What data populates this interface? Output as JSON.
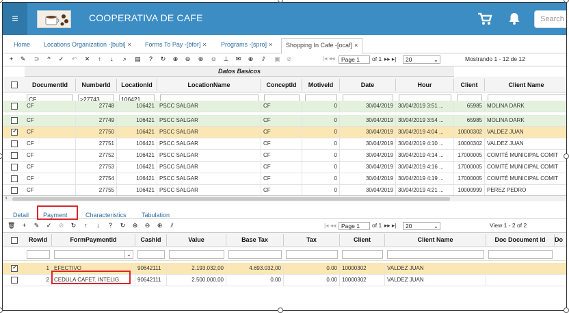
{
  "app": {
    "title": "COOPERATIVA DE CAFE",
    "search_placeholder": "Search"
  },
  "tabs": [
    {
      "label": "Home"
    },
    {
      "label": "Locations Organization -[bubi]"
    },
    {
      "label": "Forms To Pay -[bfor]"
    },
    {
      "label": "Programs -[spro]"
    },
    {
      "label": "Shopping In Cafe -[ocaf]"
    }
  ],
  "top_pager": {
    "page_label": "Page 1",
    "of_label": "of 1",
    "page_size": "20",
    "summary": "Mostrando 1 - 12 de 12"
  },
  "top_grid": {
    "group_header": "Datos Basicos",
    "columns": [
      "DocumentId",
      "NumberId",
      "LocationId",
      "LocationName",
      "ConceptId",
      "MotiveId",
      "Date",
      "Hour",
      "Client",
      "Client Name"
    ],
    "filters": {
      "document_id": "CF",
      "number_id": ">27743",
      "location_id": "106421"
    },
    "rows": [
      {
        "doc": "CF",
        "num": "27748",
        "loc": "106421",
        "name": "PSCC SALGAR",
        "concept": "CF",
        "motive": "0",
        "date": "30/04/2019",
        "hour": "30/04/2019 3:51 ...",
        "client": "65985",
        "client_name": "MOLINA DARK",
        "checked": false
      },
      {
        "doc": "CF",
        "num": "27749",
        "loc": "106421",
        "name": "PSCC SALGAR",
        "concept": "CF",
        "motive": "0",
        "date": "30/04/2019",
        "hour": "30/04/2019 3:54 ...",
        "client": "65985",
        "client_name": "MOLINA DARK",
        "checked": false
      },
      {
        "doc": "CF",
        "num": "27750",
        "loc": "106421",
        "name": "PSCC SALGAR",
        "concept": "CF",
        "motive": "0",
        "date": "30/04/2019",
        "hour": "30/04/2019 4:04 ...",
        "client": "10000302",
        "client_name": "VALDEZ JUAN",
        "checked": true
      },
      {
        "doc": "CF",
        "num": "27751",
        "loc": "106421",
        "name": "PSCC SALGAR",
        "concept": "CF",
        "motive": "0",
        "date": "30/04/2019",
        "hour": "30/04/2019 4:10 ...",
        "client": "10000302",
        "client_name": "VALDEZ JUAN",
        "checked": false
      },
      {
        "doc": "CF",
        "num": "27752",
        "loc": "106421",
        "name": "PSCC SALGAR",
        "concept": "CF",
        "motive": "0",
        "date": "30/04/2019",
        "hour": "30/04/2019 4:14 ...",
        "client": "17000005",
        "client_name": "COMITÉ MUNICIPAL COMIT",
        "checked": false
      },
      {
        "doc": "CF",
        "num": "27753",
        "loc": "106421",
        "name": "PSCC SALGAR",
        "concept": "CF",
        "motive": "0",
        "date": "30/04/2019",
        "hour": "30/04/2019 4:16 ...",
        "client": "17000005",
        "client_name": "COMITÉ MUNICIPAL COMIT",
        "checked": false
      },
      {
        "doc": "CF",
        "num": "27754",
        "loc": "106421",
        "name": "PSCC SALGAR",
        "concept": "CF",
        "motive": "0",
        "date": "30/04/2019",
        "hour": "30/04/2019 4:19 ...",
        "client": "17000005",
        "client_name": "COMITÉ MUNICIPAL COMIT",
        "checked": false
      },
      {
        "doc": "CF",
        "num": "27755",
        "loc": "106421",
        "name": "PSCC SALGAR",
        "concept": "CF",
        "motive": "0",
        "date": "30/04/2019",
        "hour": "30/04/2019 4:21 ...",
        "client": "10000999",
        "client_name": "PEREZ PEDRO",
        "checked": false
      }
    ]
  },
  "subtabs": [
    {
      "label": "Detail"
    },
    {
      "label": "Payment"
    },
    {
      "label": "Characteristics"
    },
    {
      "label": "Tabulation"
    }
  ],
  "bottom_pager": {
    "page_label": "Page 1",
    "of_label": "of 1",
    "page_size": "20",
    "summary": "View 1 - 2 of 2"
  },
  "bottom_grid": {
    "columns": [
      "RowId",
      "FormPaymentId",
      "CashId",
      "Value",
      "Base Tax",
      "Tax",
      "Client",
      "Client Name",
      "Doc Document Id",
      "Do"
    ],
    "rows": [
      {
        "row_id": "1",
        "form": "EFECTIVO",
        "cash": "90642111",
        "value": "2.193.032,00",
        "base": "4.693.032,00",
        "tax": "0.00",
        "client": "10000302",
        "client_name": "VALDEZ JUAN",
        "checked": true
      },
      {
        "row_id": "2",
        "form": "CEDULA CAFET. INTELIG.",
        "cash": "90642111",
        "value": "2.500.000,00",
        "base": "0.00",
        "tax": "0.00",
        "client": "10000302",
        "client_name": "VALDEZ JUAN",
        "checked": false
      }
    ]
  },
  "colors": {
    "topbar": "#3b8dc4",
    "selected_row": "#fbe7b3",
    "green_row": "#e3f1dd",
    "highlight": "#d9252a"
  }
}
